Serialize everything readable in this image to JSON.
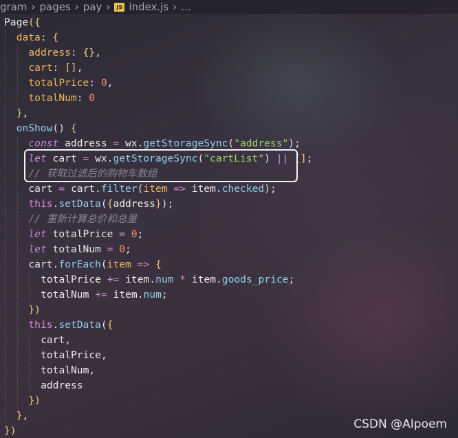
{
  "breadcrumb": {
    "items": [
      "gram",
      "pages",
      "pay"
    ],
    "file_badge": "JS",
    "file": "index.js",
    "trail": "..."
  },
  "code_lines": [
    {
      "indent": 0,
      "tokens": [
        [
          "id",
          "Page"
        ],
        [
          "brace",
          "({"
        ]
      ]
    },
    {
      "indent": 1,
      "tokens": [
        [
          "prop",
          "data"
        ],
        [
          "punc",
          ": "
        ],
        [
          "brace",
          "{"
        ]
      ]
    },
    {
      "indent": 2,
      "tokens": [
        [
          "prop",
          "address"
        ],
        [
          "punc",
          ": "
        ],
        [
          "brace",
          "{}"
        ],
        [
          "punc",
          ","
        ]
      ]
    },
    {
      "indent": 2,
      "tokens": [
        [
          "prop",
          "cart"
        ],
        [
          "punc",
          ": "
        ],
        [
          "brace",
          "[]"
        ],
        [
          "punc",
          ","
        ]
      ]
    },
    {
      "indent": 2,
      "tokens": [
        [
          "prop",
          "totalPrice"
        ],
        [
          "punc",
          ": "
        ],
        [
          "num",
          "0"
        ],
        [
          "punc",
          ","
        ]
      ]
    },
    {
      "indent": 2,
      "tokens": [
        [
          "prop",
          "totalNum"
        ],
        [
          "punc",
          ": "
        ],
        [
          "num",
          "0"
        ]
      ]
    },
    {
      "indent": 1,
      "tokens": [
        [
          "brace",
          "}"
        ],
        [
          "punc",
          ","
        ]
      ]
    },
    {
      "indent": 1,
      "tokens": [
        [
          "fn",
          "onShow"
        ],
        [
          "punc",
          "() "
        ],
        [
          "brace",
          "{"
        ]
      ]
    },
    {
      "indent": 2,
      "tokens": [
        [
          "kwi",
          "const"
        ],
        [
          "punc",
          " "
        ],
        [
          "id",
          "address"
        ],
        [
          "punc",
          " "
        ],
        [
          "op",
          "="
        ],
        [
          "punc",
          " "
        ],
        [
          "id",
          "wx"
        ],
        [
          "punc",
          "."
        ],
        [
          "fn",
          "getStorageSync"
        ],
        [
          "punc",
          "("
        ],
        [
          "str",
          "\"address\""
        ],
        [
          "punc",
          ");"
        ]
      ]
    },
    {
      "indent": 2,
      "tokens": [
        [
          "kwi",
          "let"
        ],
        [
          "punc",
          " "
        ],
        [
          "id",
          "cart"
        ],
        [
          "punc",
          " "
        ],
        [
          "op",
          "="
        ],
        [
          "punc",
          " "
        ],
        [
          "id",
          "wx"
        ],
        [
          "punc",
          "."
        ],
        [
          "fn",
          "getStorageSync"
        ],
        [
          "punc",
          "("
        ],
        [
          "str",
          "\"cartList\""
        ],
        [
          "punc",
          ") "
        ],
        [
          "op",
          "||"
        ],
        [
          "punc",
          " "
        ],
        [
          "brace",
          "[]"
        ],
        [
          "punc",
          ";"
        ]
      ]
    },
    {
      "indent": 2,
      "tokens": [
        [
          "cm",
          "// 获取过滤后的购物车数组"
        ]
      ]
    },
    {
      "indent": 2,
      "tokens": [
        [
          "id",
          "cart"
        ],
        [
          "punc",
          " "
        ],
        [
          "op",
          "="
        ],
        [
          "punc",
          " "
        ],
        [
          "id",
          "cart"
        ],
        [
          "punc",
          "."
        ],
        [
          "fn",
          "filter"
        ],
        [
          "punc",
          "("
        ],
        [
          "prop",
          "item"
        ],
        [
          "punc",
          " "
        ],
        [
          "op",
          "=>"
        ],
        [
          "punc",
          " "
        ],
        [
          "id",
          "item"
        ],
        [
          "punc",
          "."
        ],
        [
          "fn",
          "checked"
        ],
        [
          "punc",
          ");"
        ]
      ]
    },
    {
      "indent": 2,
      "tokens": [
        [
          "kw",
          "this"
        ],
        [
          "punc",
          "."
        ],
        [
          "fn",
          "setData"
        ],
        [
          "punc",
          "("
        ],
        [
          "brace",
          "{"
        ],
        [
          "id",
          "address"
        ],
        [
          "brace",
          "}"
        ],
        [
          "punc",
          ");"
        ]
      ]
    },
    {
      "indent": 2,
      "tokens": [
        [
          "cm",
          "// 重新计算总价和总量"
        ]
      ]
    },
    {
      "indent": 2,
      "tokens": [
        [
          "kwi",
          "let"
        ],
        [
          "punc",
          " "
        ],
        [
          "id",
          "totalPrice"
        ],
        [
          "punc",
          " "
        ],
        [
          "op",
          "="
        ],
        [
          "punc",
          " "
        ],
        [
          "num",
          "0"
        ],
        [
          "punc",
          ";"
        ]
      ]
    },
    {
      "indent": 2,
      "tokens": [
        [
          "kwi",
          "let"
        ],
        [
          "punc",
          " "
        ],
        [
          "id",
          "totalNum"
        ],
        [
          "punc",
          " "
        ],
        [
          "op",
          "="
        ],
        [
          "punc",
          " "
        ],
        [
          "num",
          "0"
        ],
        [
          "punc",
          ";"
        ]
      ]
    },
    {
      "indent": 2,
      "tokens": [
        [
          "id",
          "cart"
        ],
        [
          "punc",
          "."
        ],
        [
          "fn",
          "forEach"
        ],
        [
          "punc",
          "("
        ],
        [
          "prop",
          "item"
        ],
        [
          "punc",
          " "
        ],
        [
          "op",
          "=>"
        ],
        [
          "punc",
          " "
        ],
        [
          "brace",
          "{"
        ]
      ]
    },
    {
      "indent": 3,
      "tokens": [
        [
          "id",
          "totalPrice"
        ],
        [
          "punc",
          " "
        ],
        [
          "op",
          "+="
        ],
        [
          "punc",
          " "
        ],
        [
          "id",
          "item"
        ],
        [
          "punc",
          "."
        ],
        [
          "fn",
          "num"
        ],
        [
          "punc",
          " "
        ],
        [
          "op",
          "*"
        ],
        [
          "punc",
          " "
        ],
        [
          "id",
          "item"
        ],
        [
          "punc",
          "."
        ],
        [
          "fn",
          "goods_price"
        ],
        [
          "punc",
          ";"
        ]
      ]
    },
    {
      "indent": 3,
      "tokens": [
        [
          "id",
          "totalNum"
        ],
        [
          "punc",
          " "
        ],
        [
          "op",
          "+="
        ],
        [
          "punc",
          " "
        ],
        [
          "id",
          "item"
        ],
        [
          "punc",
          "."
        ],
        [
          "fn",
          "num"
        ],
        [
          "punc",
          ";"
        ]
      ]
    },
    {
      "indent": 2,
      "tokens": [
        [
          "brace",
          "})"
        ]
      ]
    },
    {
      "indent": 2,
      "tokens": [
        [
          "kw",
          "this"
        ],
        [
          "punc",
          "."
        ],
        [
          "fn",
          "setData"
        ],
        [
          "punc",
          "("
        ],
        [
          "brace",
          "{"
        ]
      ]
    },
    {
      "indent": 3,
      "tokens": [
        [
          "id",
          "cart"
        ],
        [
          "punc",
          ","
        ]
      ]
    },
    {
      "indent": 3,
      "tokens": [
        [
          "id",
          "totalPrice"
        ],
        [
          "punc",
          ","
        ]
      ]
    },
    {
      "indent": 3,
      "tokens": [
        [
          "id",
          "totalNum"
        ],
        [
          "punc",
          ","
        ]
      ]
    },
    {
      "indent": 3,
      "tokens": [
        [
          "id",
          "address"
        ]
      ]
    },
    {
      "indent": 2,
      "tokens": [
        [
          "brace",
          "})"
        ]
      ]
    },
    {
      "indent": 1,
      "tokens": [
        [
          "brace",
          "}"
        ],
        [
          "punc",
          ","
        ]
      ]
    },
    {
      "indent": 0,
      "tokens": [
        [
          "brace",
          "})"
        ]
      ]
    }
  ],
  "watermark": "CSDN @AIpoem",
  "colors": {
    "keyword": "#d58fd6",
    "function": "#8fd0e8",
    "property": "#f0b95d",
    "number": "#f08f6a",
    "string": "#9fd36a",
    "comment": "#8c8493",
    "highlight_border": "#f4f4f4"
  },
  "highlighted_lines": [
    10,
    11
  ]
}
